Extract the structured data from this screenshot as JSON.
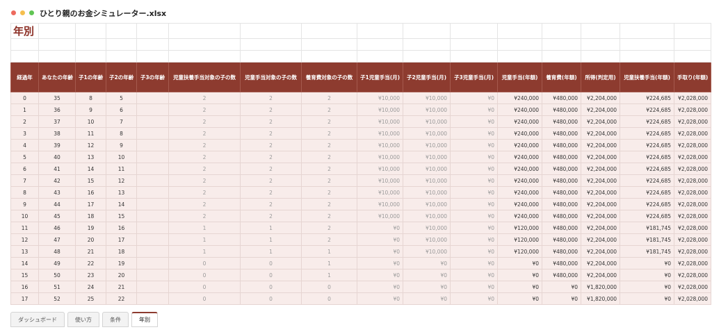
{
  "window": {
    "title": "ひとり親のお金シミュレーター.xlsx"
  },
  "sheet": {
    "title": "年別",
    "headers": [
      "経過年",
      "あなたの年齢",
      "子1の年齢",
      "子2の年齢",
      "子3の年齢",
      "児童扶養手当対象の子の数",
      "児童手当対象の子の数",
      "養育費対象の子の数",
      "子1児童手当(月)",
      "子2児童手当(月)",
      "子3児童手当(月)",
      "児童手当(年額)",
      "養育費(年額)",
      "所得(判定用)",
      "児童扶養手当(年額)",
      "手取り(年額)"
    ],
    "rows": [
      [
        "0",
        "35",
        "8",
        "5",
        "",
        "2",
        "2",
        "2",
        "¥10,000",
        "¥10,000",
        "¥0",
        "¥240,000",
        "¥480,000",
        "¥2,204,000",
        "¥224,685",
        "¥2,028,000"
      ],
      [
        "1",
        "36",
        "9",
        "6",
        "",
        "2",
        "2",
        "2",
        "¥10,000",
        "¥10,000",
        "¥0",
        "¥240,000",
        "¥480,000",
        "¥2,204,000",
        "¥224,685",
        "¥2,028,000"
      ],
      [
        "2",
        "37",
        "10",
        "7",
        "",
        "2",
        "2",
        "2",
        "¥10,000",
        "¥10,000",
        "¥0",
        "¥240,000",
        "¥480,000",
        "¥2,204,000",
        "¥224,685",
        "¥2,028,000"
      ],
      [
        "3",
        "38",
        "11",
        "8",
        "",
        "2",
        "2",
        "2",
        "¥10,000",
        "¥10,000",
        "¥0",
        "¥240,000",
        "¥480,000",
        "¥2,204,000",
        "¥224,685",
        "¥2,028,000"
      ],
      [
        "4",
        "39",
        "12",
        "9",
        "",
        "2",
        "2",
        "2",
        "¥10,000",
        "¥10,000",
        "¥0",
        "¥240,000",
        "¥480,000",
        "¥2,204,000",
        "¥224,685",
        "¥2,028,000"
      ],
      [
        "5",
        "40",
        "13",
        "10",
        "",
        "2",
        "2",
        "2",
        "¥10,000",
        "¥10,000",
        "¥0",
        "¥240,000",
        "¥480,000",
        "¥2,204,000",
        "¥224,685",
        "¥2,028,000"
      ],
      [
        "6",
        "41",
        "14",
        "11",
        "",
        "2",
        "2",
        "2",
        "¥10,000",
        "¥10,000",
        "¥0",
        "¥240,000",
        "¥480,000",
        "¥2,204,000",
        "¥224,685",
        "¥2,028,000"
      ],
      [
        "7",
        "42",
        "15",
        "12",
        "",
        "2",
        "2",
        "2",
        "¥10,000",
        "¥10,000",
        "¥0",
        "¥240,000",
        "¥480,000",
        "¥2,204,000",
        "¥224,685",
        "¥2,028,000"
      ],
      [
        "8",
        "43",
        "16",
        "13",
        "",
        "2",
        "2",
        "2",
        "¥10,000",
        "¥10,000",
        "¥0",
        "¥240,000",
        "¥480,000",
        "¥2,204,000",
        "¥224,685",
        "¥2,028,000"
      ],
      [
        "9",
        "44",
        "17",
        "14",
        "",
        "2",
        "2",
        "2",
        "¥10,000",
        "¥10,000",
        "¥0",
        "¥240,000",
        "¥480,000",
        "¥2,204,000",
        "¥224,685",
        "¥2,028,000"
      ],
      [
        "10",
        "45",
        "18",
        "15",
        "",
        "2",
        "2",
        "2",
        "¥10,000",
        "¥10,000",
        "¥0",
        "¥240,000",
        "¥480,000",
        "¥2,204,000",
        "¥224,685",
        "¥2,028,000"
      ],
      [
        "11",
        "46",
        "19",
        "16",
        "",
        "1",
        "1",
        "2",
        "¥0",
        "¥10,000",
        "¥0",
        "¥120,000",
        "¥480,000",
        "¥2,204,000",
        "¥181,745",
        "¥2,028,000"
      ],
      [
        "12",
        "47",
        "20",
        "17",
        "",
        "1",
        "1",
        "2",
        "¥0",
        "¥10,000",
        "¥0",
        "¥120,000",
        "¥480,000",
        "¥2,204,000",
        "¥181,745",
        "¥2,028,000"
      ],
      [
        "13",
        "48",
        "21",
        "18",
        "",
        "1",
        "1",
        "1",
        "¥0",
        "¥10,000",
        "¥0",
        "¥120,000",
        "¥480,000",
        "¥2,204,000",
        "¥181,745",
        "¥2,028,000"
      ],
      [
        "14",
        "49",
        "22",
        "19",
        "",
        "0",
        "0",
        "1",
        "¥0",
        "¥0",
        "¥0",
        "¥0",
        "¥480,000",
        "¥2,204,000",
        "¥0",
        "¥2,028,000"
      ],
      [
        "15",
        "50",
        "23",
        "20",
        "",
        "0",
        "0",
        "1",
        "¥0",
        "¥0",
        "¥0",
        "¥0",
        "¥480,000",
        "¥2,204,000",
        "¥0",
        "¥2,028,000"
      ],
      [
        "16",
        "51",
        "24",
        "21",
        "",
        "0",
        "0",
        "0",
        "¥0",
        "¥0",
        "¥0",
        "¥0",
        "¥0",
        "¥1,820,000",
        "¥0",
        "¥2,028,000"
      ],
      [
        "17",
        "52",
        "25",
        "22",
        "",
        "0",
        "0",
        "0",
        "¥0",
        "¥0",
        "¥0",
        "¥0",
        "¥0",
        "¥1,820,000",
        "¥0",
        "¥2,028,000"
      ]
    ]
  },
  "tabs": [
    {
      "label": "ダッシュボード",
      "active": false
    },
    {
      "label": "使い方",
      "active": false
    },
    {
      "label": "条件",
      "active": false
    },
    {
      "label": "年別",
      "active": true
    }
  ],
  "colors": {
    "header": "#8d3b2f",
    "row": "#f8ecea",
    "title": "#8b2e24"
  }
}
